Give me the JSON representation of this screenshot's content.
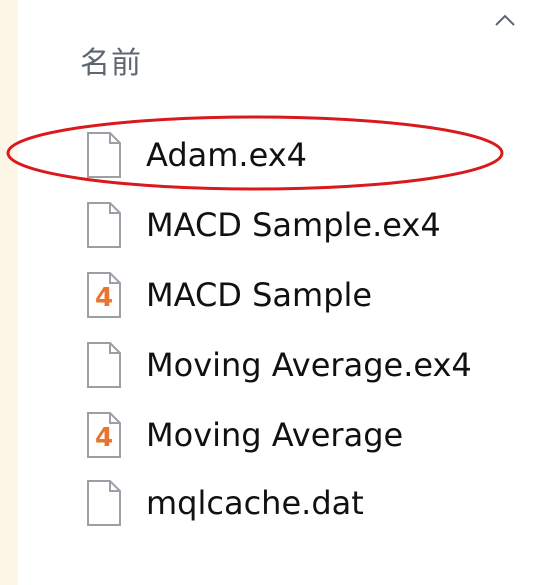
{
  "header": {
    "column_label": "名前",
    "sort_icon": "chevron-up-icon"
  },
  "files": [
    {
      "name": "Adam.ex4",
      "icon": "blank-file-icon",
      "highlighted": true
    },
    {
      "name": "MACD Sample.ex4",
      "icon": "blank-file-icon",
      "highlighted": false
    },
    {
      "name": "MACD Sample",
      "icon": "mq4-source-file-icon",
      "highlighted": false
    },
    {
      "name": "Moving Average.ex4",
      "icon": "blank-file-icon",
      "highlighted": false
    },
    {
      "name": "Moving Average",
      "icon": "mq4-source-file-icon",
      "highlighted": false
    },
    {
      "name": "mqlcache.dat",
      "icon": "blank-file-icon",
      "highlighted": false
    }
  ],
  "colors": {
    "background": "#fdf6e6",
    "panel": "#ffffff",
    "highlight": "#d9191c",
    "mq4_badge": "#e8742e"
  }
}
